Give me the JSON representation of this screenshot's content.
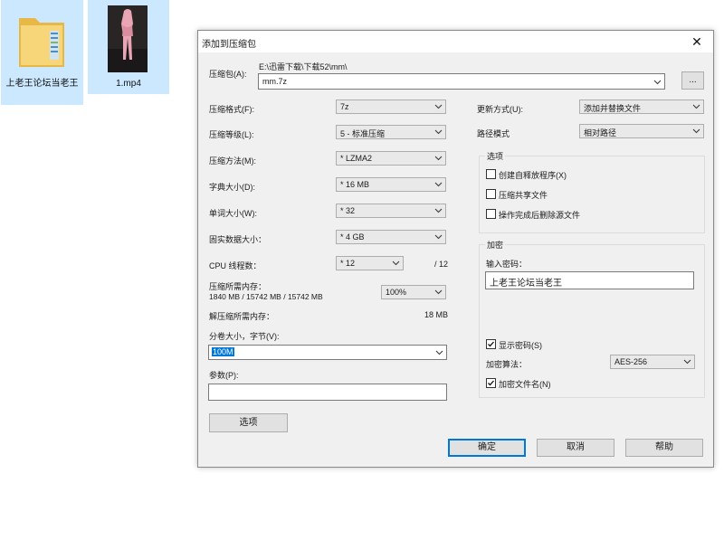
{
  "desktop": {
    "items": [
      {
        "label": "上老王论坛当老王",
        "icon": "folder-icon"
      },
      {
        "label": "1.mp4",
        "icon": "video-thumbnail"
      }
    ]
  },
  "dialog": {
    "title": "添加到压缩包",
    "close_glyph": "✕",
    "archive": {
      "label": "压缩包(A):",
      "path": "E:\\迅雷下载\\下载52\\mm\\",
      "value": "mm.7z",
      "browse_label": "..."
    },
    "left": {
      "format": {
        "label": "压缩格式(F):",
        "value": "7z"
      },
      "level": {
        "label": "压缩等级(L):",
        "value": "5 - 标准压缩"
      },
      "method": {
        "label": "压缩方法(M):",
        "value": "* LZMA2"
      },
      "dict": {
        "label": "字典大小(D):",
        "value": "* 16 MB"
      },
      "word": {
        "label": "单词大小(W):",
        "value": "* 32"
      },
      "solid": {
        "label": "固实数据大小：",
        "value": "* 4 GB"
      },
      "cpu": {
        "label": "CPU 线程数：",
        "value": "* 12",
        "total": "/ 12"
      },
      "mem": {
        "label": "压缩所需内存：",
        "detail": "1840 MB / 15742 MB / 15742 MB",
        "value": "100%"
      },
      "decomp": {
        "label": "解压缩所需内存：",
        "value": "18 MB"
      },
      "split": {
        "label": "分卷大小，字节(V):",
        "value": "100M"
      },
      "params": {
        "label": "参数(P):",
        "value": ""
      },
      "options_button": "选项"
    },
    "right": {
      "update": {
        "label": "更新方式(U):",
        "value": "添加并替换文件"
      },
      "pathmode": {
        "label": "路径模式",
        "value": "相对路径"
      },
      "options_group": {
        "title": "选项",
        "sfx": {
          "label": "创建自释放程序(X)",
          "checked": false
        },
        "shared": {
          "label": "压缩共享文件",
          "checked": false
        },
        "delete": {
          "label": "操作完成后删除源文件",
          "checked": false
        }
      },
      "encrypt_group": {
        "title": "加密",
        "password_label": "输入密码：",
        "password_value": "上老王论坛当老王",
        "show_password": {
          "label": "显示密码(S)",
          "checked": true
        },
        "algo": {
          "label": "加密算法：",
          "value": "AES-256"
        },
        "encrypt_names": {
          "label": "加密文件名(N)",
          "checked": true
        }
      }
    },
    "buttons": {
      "ok": "确定",
      "cancel": "取消",
      "help": "帮助"
    }
  }
}
